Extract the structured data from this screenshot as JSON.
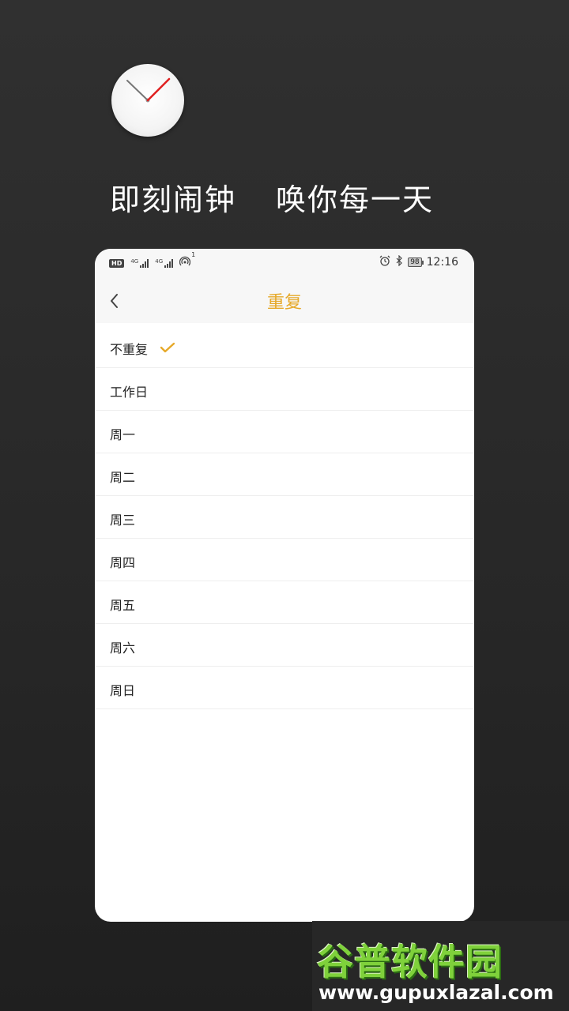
{
  "promo": {
    "tagline_left": "即刻闹钟",
    "tagline_right": "唤你每一天"
  },
  "statusbar": {
    "hd": "HD",
    "sig1": "4G",
    "sig2": "4G",
    "hotspot_count": "1",
    "battery": "98",
    "time": "12:16"
  },
  "navbar": {
    "title": "重复"
  },
  "repeat_options": [
    {
      "label": "不重复",
      "selected": true
    },
    {
      "label": "工作日",
      "selected": false
    },
    {
      "label": "周一",
      "selected": false
    },
    {
      "label": "周二",
      "selected": false
    },
    {
      "label": "周三",
      "selected": false
    },
    {
      "label": "周四",
      "selected": false
    },
    {
      "label": "周五",
      "selected": false
    },
    {
      "label": "周六",
      "selected": false
    },
    {
      "label": "周日",
      "selected": false
    }
  ],
  "colors": {
    "accent": "#e6a92a",
    "background": "#2b2b2b",
    "clock_hand": "#e02020"
  },
  "watermark": {
    "title": "谷普软件园",
    "url": "www.gupuxlazal.com"
  },
  "icons": {
    "clock": "clock-icon",
    "back": "chevron-left-icon",
    "check": "check-icon",
    "alarm": "alarm-icon",
    "bluetooth": "bluetooth-icon",
    "hotspot": "hotspot-icon"
  }
}
